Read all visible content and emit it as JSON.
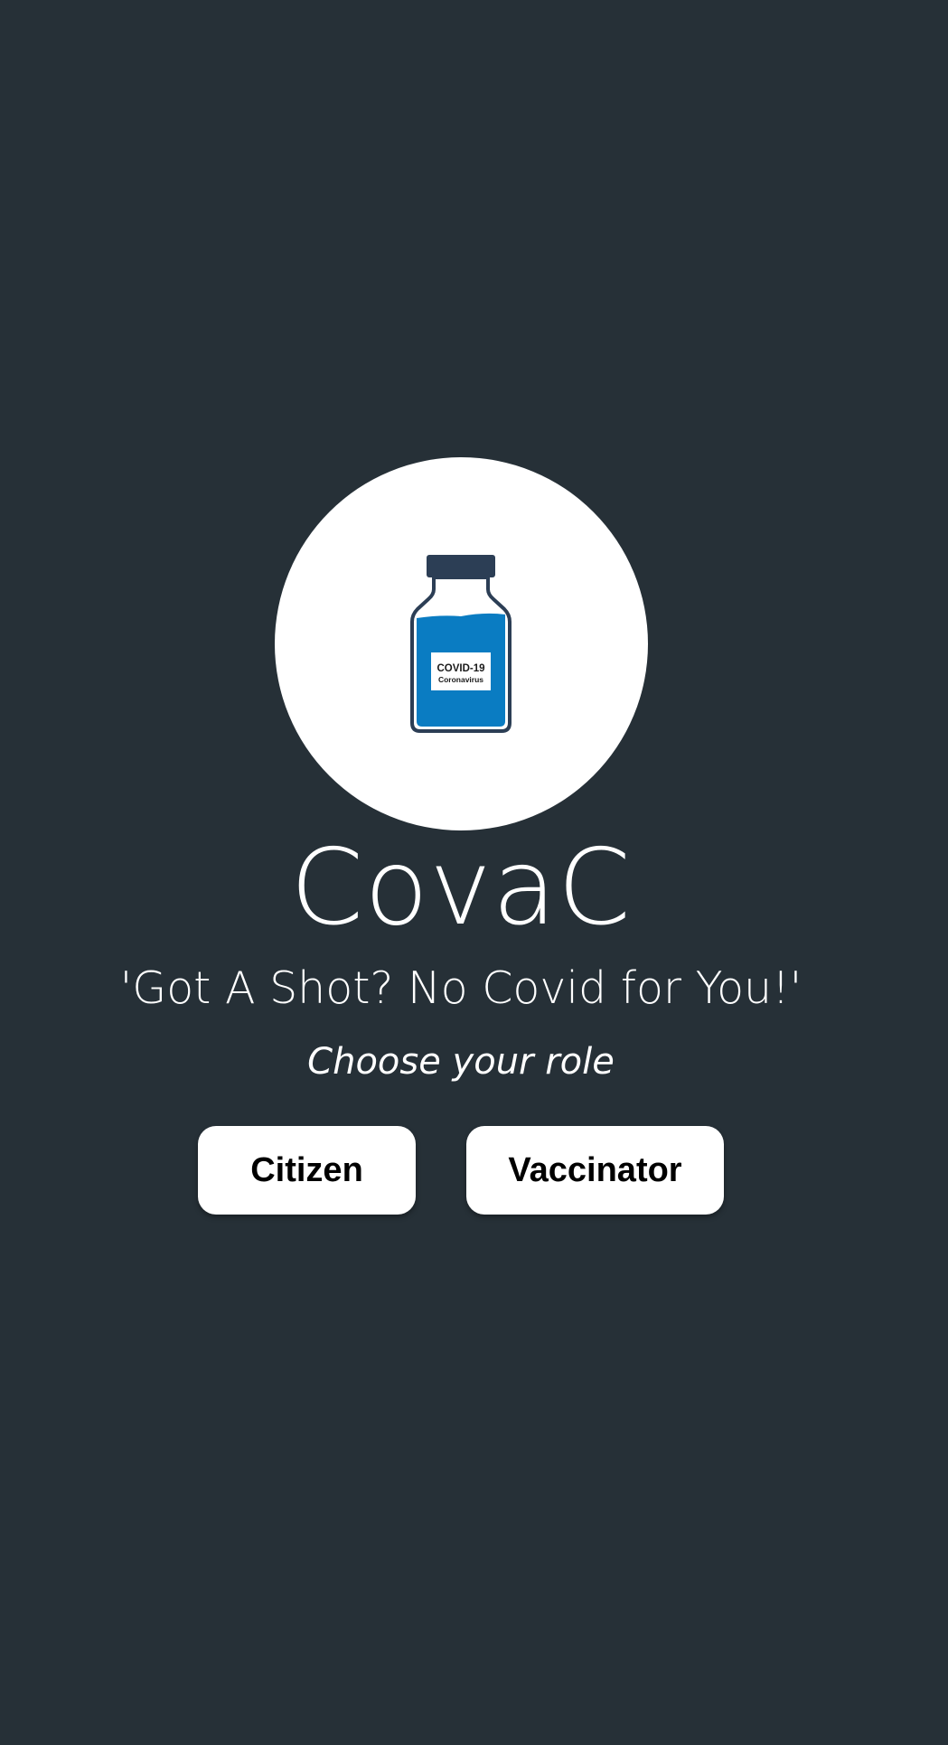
{
  "app": {
    "title": "CovaC",
    "tagline": "'Got A Shot? No Covid for You!'",
    "role_prompt": "Choose your role"
  },
  "logo": {
    "icon": "vaccine-vial-icon",
    "vial_label_line1": "COVID-19",
    "vial_label_line2": "Coronavirus",
    "colors": {
      "cap": "#2c3e55",
      "liquid": "#0a7cc2",
      "circle": "#ffffff"
    }
  },
  "roles": {
    "citizen_label": "Citizen",
    "vaccinator_label": "Vaccinator"
  },
  "theme": {
    "background": "#263037",
    "text": "#ffffff",
    "button_background": "#ffffff",
    "button_text": "#000000"
  }
}
